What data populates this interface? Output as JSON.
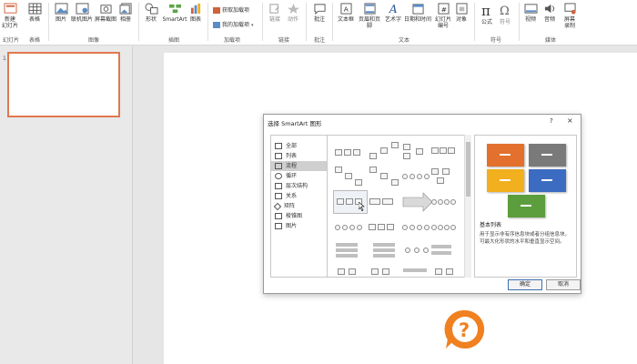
{
  "ribbon": {
    "items": [
      {
        "label": "新建\n幻灯片",
        "icon": "new-slide-icon"
      },
      {
        "label": "表格",
        "icon": "table-icon"
      },
      {
        "label": "图片",
        "icon": "picture-icon"
      },
      {
        "label": "联机图片",
        "icon": "online-picture-icon"
      },
      {
        "label": "屏幕截图",
        "icon": "screenshot-icon"
      },
      {
        "label": "相册",
        "icon": "album-icon"
      },
      {
        "label": "形状",
        "icon": "shapes-icon"
      },
      {
        "label": "SmartArt",
        "icon": "smartart-icon"
      },
      {
        "label": "图表",
        "icon": "chart-icon"
      },
      {
        "label": "链接",
        "icon": "link-icon"
      },
      {
        "label": "动作",
        "icon": "action-icon"
      },
      {
        "label": "批注",
        "icon": "comment-icon"
      },
      {
        "label": "文本框",
        "icon": "textbox-icon"
      },
      {
        "label": "页眉和页脚",
        "icon": "header-footer-icon"
      },
      {
        "label": "艺术字",
        "icon": "wordart-icon"
      },
      {
        "label": "日期和时间",
        "icon": "date-time-icon"
      },
      {
        "label": "幻灯片\n编号",
        "icon": "slide-number-icon"
      },
      {
        "label": "对象",
        "icon": "object-icon"
      },
      {
        "label": "公式",
        "icon": "equation-icon"
      },
      {
        "label": "符号",
        "icon": "symbol-icon"
      },
      {
        "label": "视频",
        "icon": "video-icon"
      },
      {
        "label": "音频",
        "icon": "audio-icon"
      },
      {
        "label": "屏幕\n录制",
        "icon": "screen-record-icon"
      }
    ],
    "addins": {
      "get": "获取加载项",
      "mine": "我的加载项"
    },
    "groups": {
      "slides": "幻灯片",
      "tables": "表格",
      "images": "图像",
      "illustrations": "插图",
      "addins": "加载项",
      "links": "链接",
      "comments": "批注",
      "text": "文本",
      "symbols": "符号",
      "media": "媒体"
    }
  },
  "thumbnails": {
    "slide_number": "1"
  },
  "dialog": {
    "title": "选择 SmartArt 图形",
    "help": "?",
    "close": "×",
    "categories": [
      {
        "label": "全部",
        "icon": "all-icon"
      },
      {
        "label": "列表",
        "icon": "list-icon"
      },
      {
        "label": "流程",
        "icon": "process-icon"
      },
      {
        "label": "循环",
        "icon": "cycle-icon"
      },
      {
        "label": "层次结构",
        "icon": "hierarchy-icon"
      },
      {
        "label": "关系",
        "icon": "relationship-icon"
      },
      {
        "label": "矩阵",
        "icon": "matrix-icon"
      },
      {
        "label": "棱锥图",
        "icon": "pyramid-icon"
      },
      {
        "label": "图片",
        "icon": "picture-icon"
      }
    ],
    "selected_category": "流程",
    "preview": {
      "name": "基本列表",
      "description": "用于显示非有序信息块或者分组信息块。可最大化形状的水平和垂直显示空间。",
      "colors": [
        "#e3702c",
        "#7a7a7a",
        "#f2b01e",
        "#3b6cc2",
        "#5c9d3e"
      ]
    },
    "ok": "确定",
    "cancel": "取消"
  }
}
